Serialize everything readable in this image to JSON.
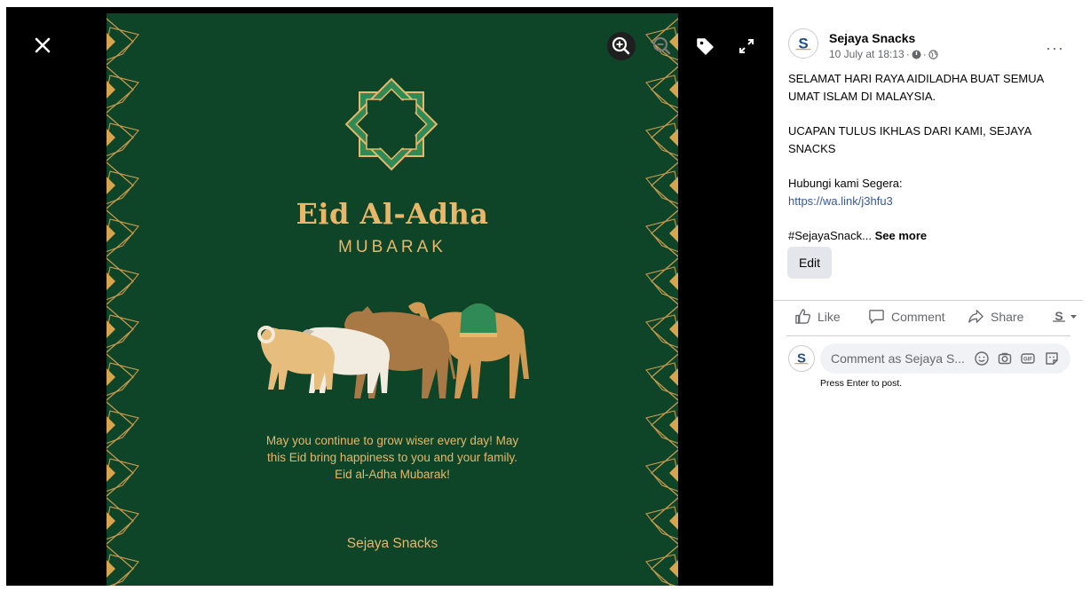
{
  "post": {
    "page_name": "Sejaya Snacks",
    "timestamp": "10 July at 18:13",
    "meta_separator": "·",
    "privacy_icon": "globe-icon",
    "paragraphs": [
      "SELAMAT HARI RAYA AIDILADHA BUAT SEMUA UMAT ISLAM DI MALAYSIA.",
      "UCAPAN TULUS IKHLAS DARI KAMI, SEJAYA SNACKS"
    ],
    "contact_label": "Hubungi kami Segera:",
    "link": "https://wa.link/j3hfu3",
    "hashtag_truncated": "#SejayaSnack...",
    "see_more": "See more",
    "edit_label": "Edit",
    "more_label": "···"
  },
  "actions": {
    "like": "Like",
    "comment": "Comment",
    "share": "Share"
  },
  "comment_box": {
    "placeholder": "Comment as Sejaya S...",
    "hint": "Press Enter to post.",
    "icons": [
      "emoji-icon",
      "camera-icon",
      "gif-icon",
      "sticker-icon"
    ]
  },
  "viewer": {
    "tools": [
      "close-icon",
      "zoom-in-icon",
      "zoom-out-icon",
      "tag-icon",
      "expand-icon"
    ]
  },
  "photo": {
    "title": "Eid Al-Adha",
    "subtitle": "MUBARAK",
    "message": "May you continue to grow wiser every day! May this Eid bring happiness to you and your family. Eid al-Adha Mubarak!",
    "signature": "Sejaya Snacks",
    "colors": {
      "background": "#0e4428",
      "gold": "#e8b76a",
      "accent_green": "#2f8a55"
    }
  }
}
